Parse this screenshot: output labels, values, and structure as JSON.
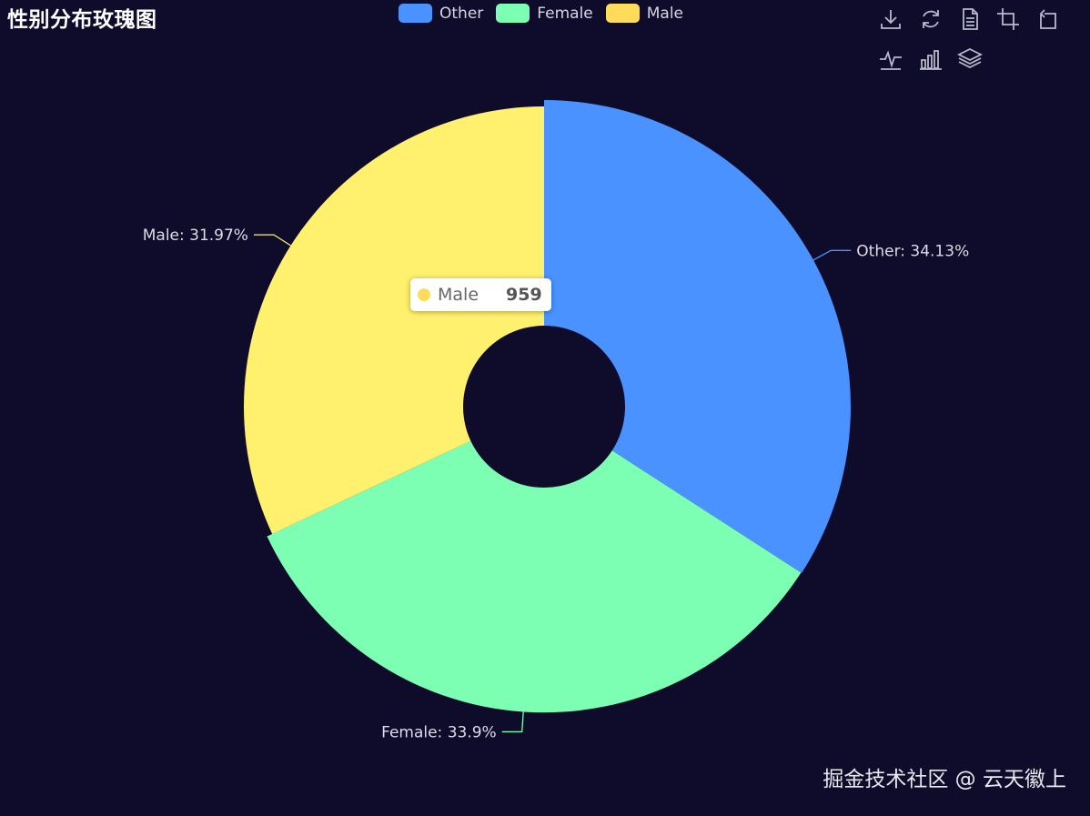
{
  "title": "性别分布玫瑰图",
  "toolbox": {
    "icons": [
      "download-icon",
      "refresh-icon",
      "data-view-icon",
      "zoom-icon",
      "zoom-reset-icon",
      "line-chart-icon",
      "bar-chart-icon",
      "stack-icon"
    ]
  },
  "tooltip": {
    "name": "Male",
    "value": "959",
    "color": "#ffdb5c"
  },
  "watermark": "掘金技术社区 @ 云天徽上",
  "chart_data": {
    "type": "pie",
    "title": "性别分布玫瑰图",
    "legend": {
      "placement": "top-center",
      "entries": [
        "Other",
        "Female",
        "Male"
      ]
    },
    "series": [
      {
        "name": "",
        "data": [
          {
            "name": "Other",
            "percent": 34.13,
            "color": "#4992ff",
            "label": "Other: 34.13%"
          },
          {
            "name": "Female",
            "percent": 33.9,
            "color": "#7cffb2",
            "label": "Female: 33.9%"
          },
          {
            "name": "Male",
            "percent": 31.97,
            "value": 959,
            "color": "#fff06d",
            "label": "Male: 31.97%"
          }
        ]
      }
    ],
    "legend_colors": {
      "Other": "#4992ff",
      "Female": "#7cffb2",
      "Male": "#ffdb5c"
    }
  }
}
